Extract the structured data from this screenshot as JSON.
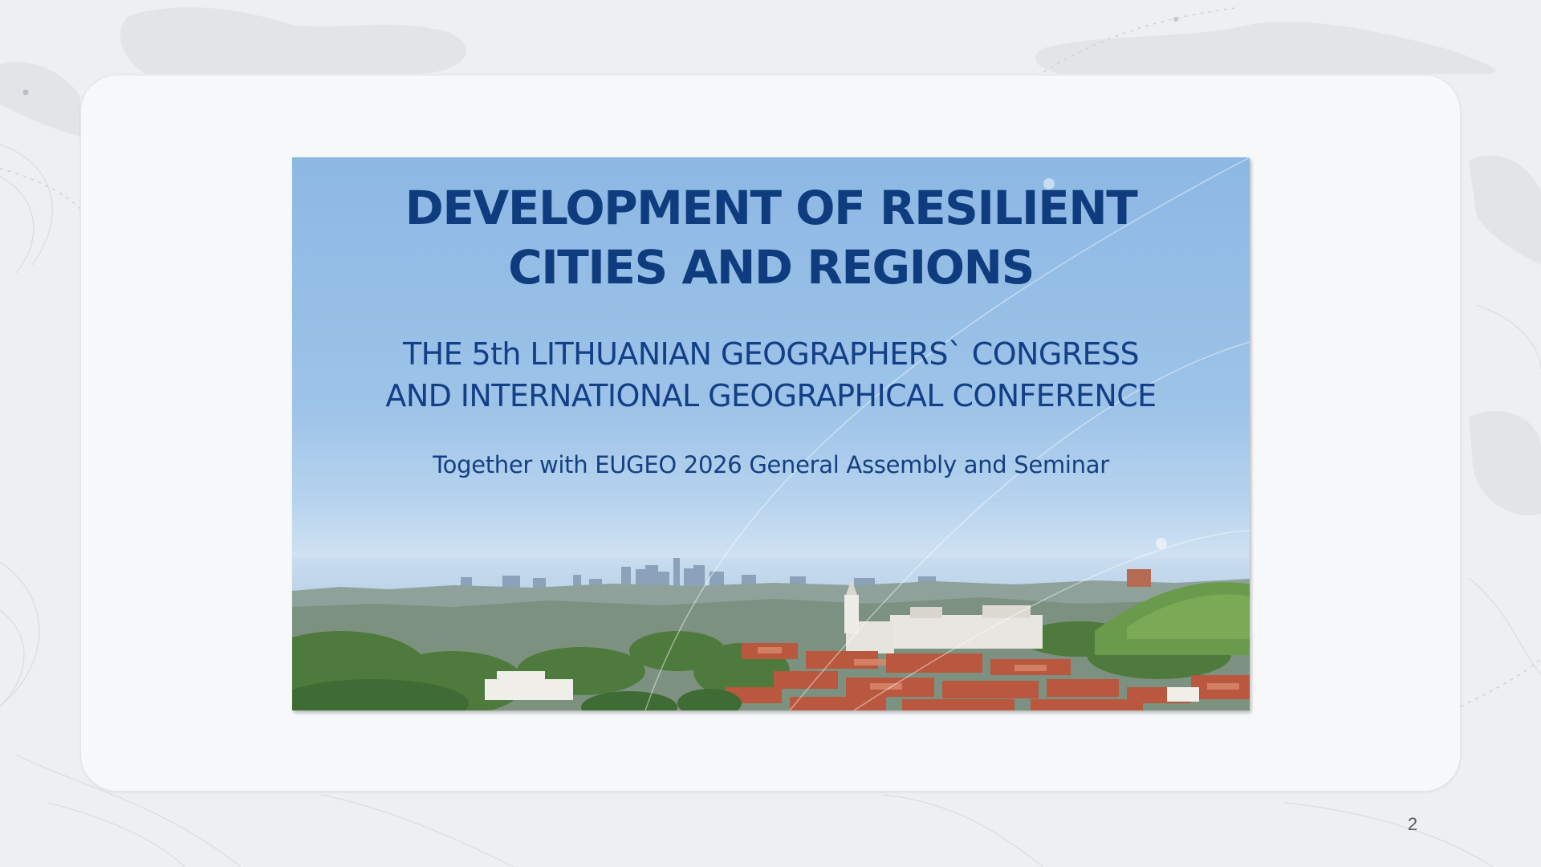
{
  "slide": {
    "title_line1": "DEVELOPMENT OF RESILIENT",
    "title_line2": "CITIES AND REGIONS",
    "subtitle_line1": "THE 5th LITHUANIAN GEOGRAPHERS` CONGRESS",
    "subtitle_line2": "AND INTERNATIONAL GEOGRAPHICAL CONFERENCE",
    "tagline": "Together with EUGEO 2026 General Assembly and Seminar"
  },
  "page_number": "2",
  "colors": {
    "title": "#0f3c7e",
    "sky_top": "#8db8e4",
    "card": "#f6f8fa",
    "background": "#edeff1"
  }
}
